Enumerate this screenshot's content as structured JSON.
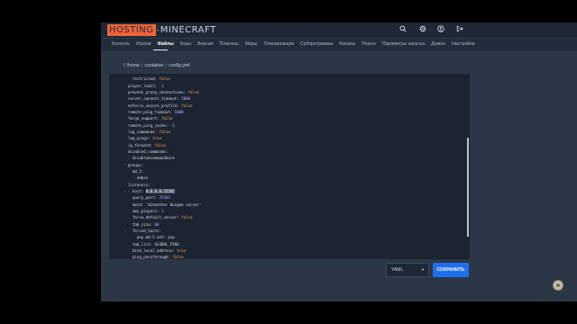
{
  "logo": {
    "part1": "HOSTING",
    "separator": "-",
    "part2": "MINECRAFT"
  },
  "topbar_icons": [
    "search-icon",
    "settings-icon",
    "user-icon",
    "logout-icon"
  ],
  "menu": {
    "items": [
      "Консоль",
      "Игроки",
      "Файлы",
      "Базы",
      "Версия",
      "Плагины",
      "Миры",
      "Планировщик",
      "Субпрограммы",
      "Бэкапы",
      "Порты",
      "Параметры запуска",
      "Домен",
      "Настройки"
    ],
    "active_index": 2
  },
  "breadcrumb": {
    "root": "/home",
    "folder": "container",
    "file": "config.yml",
    "sep": "/"
  },
  "editor": {
    "lines": [
      {
        "indent": 2,
        "key": "restricted",
        "value": "false",
        "type": "bool"
      },
      {
        "indent": 0,
        "key": "player_limit",
        "value": "-1",
        "type": "num"
      },
      {
        "indent": 0,
        "key": "prevent_proxy_connections",
        "value": "false",
        "type": "bool"
      },
      {
        "indent": 0,
        "key": "server_connect_timeout",
        "value": "5000",
        "type": "num"
      },
      {
        "indent": 0,
        "key": "enforce_secure_profile",
        "value": "false",
        "type": "bool"
      },
      {
        "indent": 0,
        "key": "remote_ping_timeout",
        "value": "5000",
        "type": "num"
      },
      {
        "indent": 0,
        "key": "forge_support",
        "value": "false",
        "type": "bool"
      },
      {
        "indent": 0,
        "key": "remote_ping_cache",
        "value": "-1",
        "type": "num"
      },
      {
        "indent": 0,
        "key": "log_commands",
        "value": "false",
        "type": "bool"
      },
      {
        "indent": 0,
        "key": "log_pings",
        "value": "true",
        "type": "bool"
      },
      {
        "indent": 0,
        "key": "ip_forward",
        "value": "false",
        "type": "bool"
      },
      {
        "indent": 0,
        "key": "disabled_commands",
        "value": "",
        "type": "none"
      },
      {
        "indent": 0,
        "key": "",
        "value": "- disabledcommandhere",
        "type": "str"
      },
      {
        "indent": 0,
        "key": "groups",
        "value": "",
        "type": "none",
        "fold": true
      },
      {
        "indent": 2,
        "key": "md_5",
        "value": "",
        "type": "none"
      },
      {
        "indent": 2,
        "key": "",
        "value": "- admin",
        "type": "str"
      },
      {
        "indent": 0,
        "key": "listeners",
        "value": "",
        "type": "none"
      },
      {
        "indent": 0,
        "key": "- host",
        "value": "0.0.0.0:25565",
        "type": "hl",
        "fold": true
      },
      {
        "indent": 2,
        "key": "query_port",
        "value": "25565",
        "type": "num"
      },
      {
        "indent": 2,
        "key": "motd",
        "value": "'&1Another Bungee server'",
        "type": "str"
      },
      {
        "indent": 2,
        "key": "max_players",
        "value": "1",
        "type": "num"
      },
      {
        "indent": 2,
        "key": "force_default_server",
        "value": "false",
        "type": "bool"
      },
      {
        "indent": 2,
        "key": "tab_size",
        "value": "60",
        "type": "num"
      },
      {
        "indent": 2,
        "key": "forced_hosts",
        "value": "",
        "type": "none",
        "fold": true
      },
      {
        "indent": 4,
        "key": "pvp.md-5.net",
        "value": "pvp",
        "type": "str"
      },
      {
        "indent": 2,
        "key": "tab_list",
        "value": "GLOBAL_PING",
        "type": "str"
      },
      {
        "indent": 2,
        "key": "bind_local_address",
        "value": "true",
        "type": "bool"
      },
      {
        "indent": 2,
        "key": "ping_passthrough",
        "value": "false",
        "type": "bool"
      }
    ]
  },
  "format_select": {
    "value": "YAML"
  },
  "save_button": {
    "label": "СОХРАНИТЬ"
  }
}
